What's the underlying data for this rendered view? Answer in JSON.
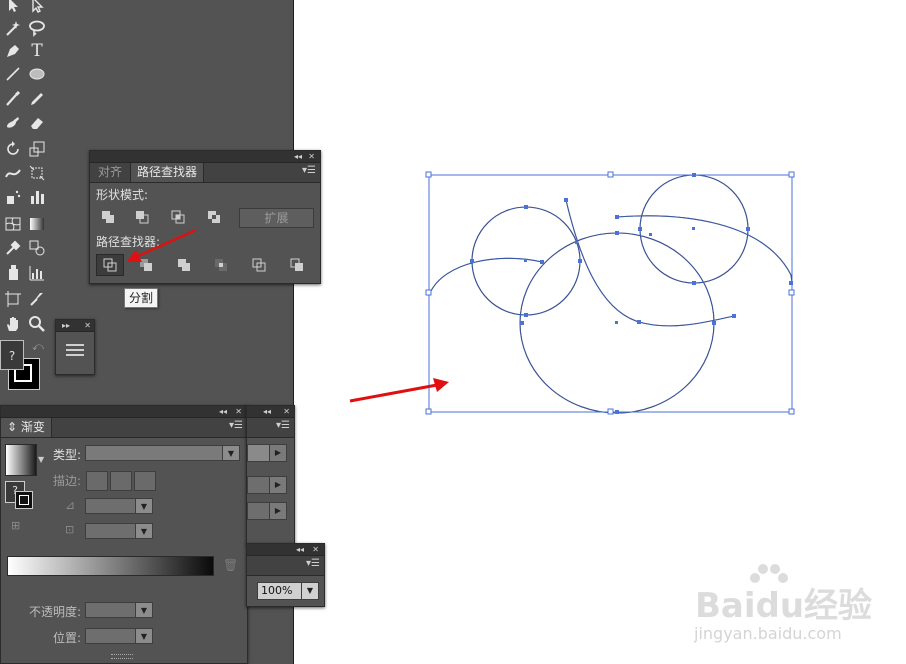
{
  "pathfinder_panel": {
    "tabs": [
      "对齐",
      "路径查找器"
    ],
    "shape_modes_label": "形状模式:",
    "expand_label": "扩展",
    "pathfinders_label": "路径查找器:",
    "tooltip": "分割"
  },
  "gradient_panel": {
    "tab": "渐变",
    "type_label": "类型:",
    "stroke_label": "描边:",
    "opacity_label": "不透明度:",
    "location_label": "位置:",
    "help": "?"
  },
  "small_panel": {
    "zoom_value": "100%"
  },
  "toolbar": {
    "help": "?"
  },
  "watermark": {
    "brand": "Baidu经验",
    "url": "jingyan.baidu.com"
  },
  "colors": {
    "selection_blue": "#4a72d8",
    "path_navy": "#2a3660",
    "arrow_red": "#e01010"
  },
  "icons": [
    "selection-icon",
    "direct-selection-icon",
    "magic-wand-icon",
    "lasso-icon",
    "pen-icon",
    "type-icon",
    "line-icon",
    "ellipse-icon",
    "paintbrush-icon",
    "pencil-icon",
    "blob-brush-icon",
    "eraser-icon",
    "rotate-icon",
    "scale-icon",
    "warp-icon",
    "free-transform-icon",
    "symbol-sprayer-icon",
    "graph-icon",
    "mesh-icon",
    "gradient-icon",
    "eyedropper-icon",
    "blend-icon",
    "live-paint-icon",
    "column-graph-icon",
    "artboard-icon",
    "slice-icon",
    "hand-icon",
    "zoom-icon"
  ]
}
